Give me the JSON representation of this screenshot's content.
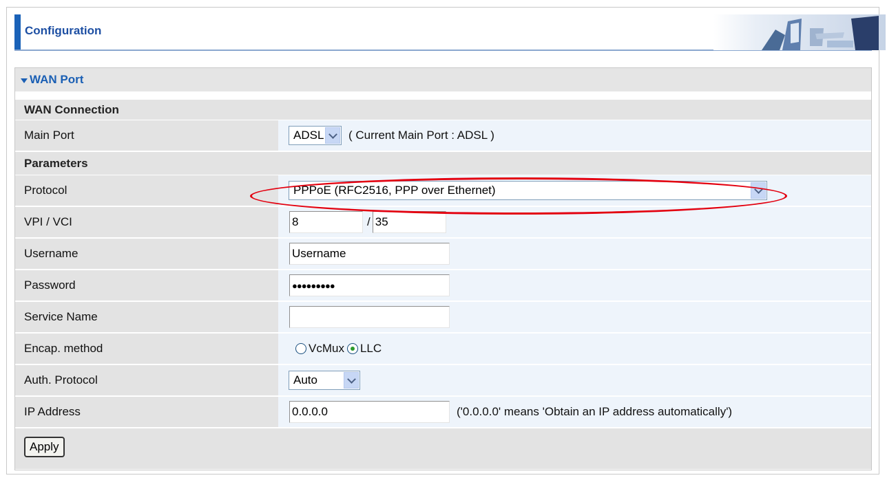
{
  "header": {
    "title": "Configuration",
    "banner_icon": "office-photo-banner"
  },
  "section": {
    "title": "WAN Port"
  },
  "groups": {
    "wan_connection": "WAN Connection",
    "parameters": "Parameters"
  },
  "main_port": {
    "label": "Main Port",
    "value": "ADSL",
    "note": "( Current Main Port : ADSL )"
  },
  "protocol": {
    "label": "Protocol",
    "value": "PPPoE (RFC2516, PPP over Ethernet)"
  },
  "vpi_vci": {
    "label": "VPI / VCI",
    "vpi": "8",
    "separator": "/",
    "vci": "35"
  },
  "username": {
    "label": "Username",
    "value": "Username"
  },
  "password": {
    "label": "Password",
    "value": "●●●●●●●●●"
  },
  "service_name": {
    "label": "Service Name",
    "value": ""
  },
  "encap": {
    "label": "Encap. method",
    "options": [
      "VcMux",
      "LLC"
    ],
    "selected": "LLC"
  },
  "auth": {
    "label": "Auth. Protocol",
    "value": "Auto"
  },
  "ip": {
    "label": "IP Address",
    "value": "0.0.0.0",
    "note": "('0.0.0.0' means 'Obtain an IP address automatically')"
  },
  "actions": {
    "apply_label": "Apply"
  },
  "colors": {
    "accent": "#1a5fb4",
    "highlight": "#e3000f",
    "label_bg": "#e3e3e3",
    "field_bg": "#eef4fb"
  }
}
